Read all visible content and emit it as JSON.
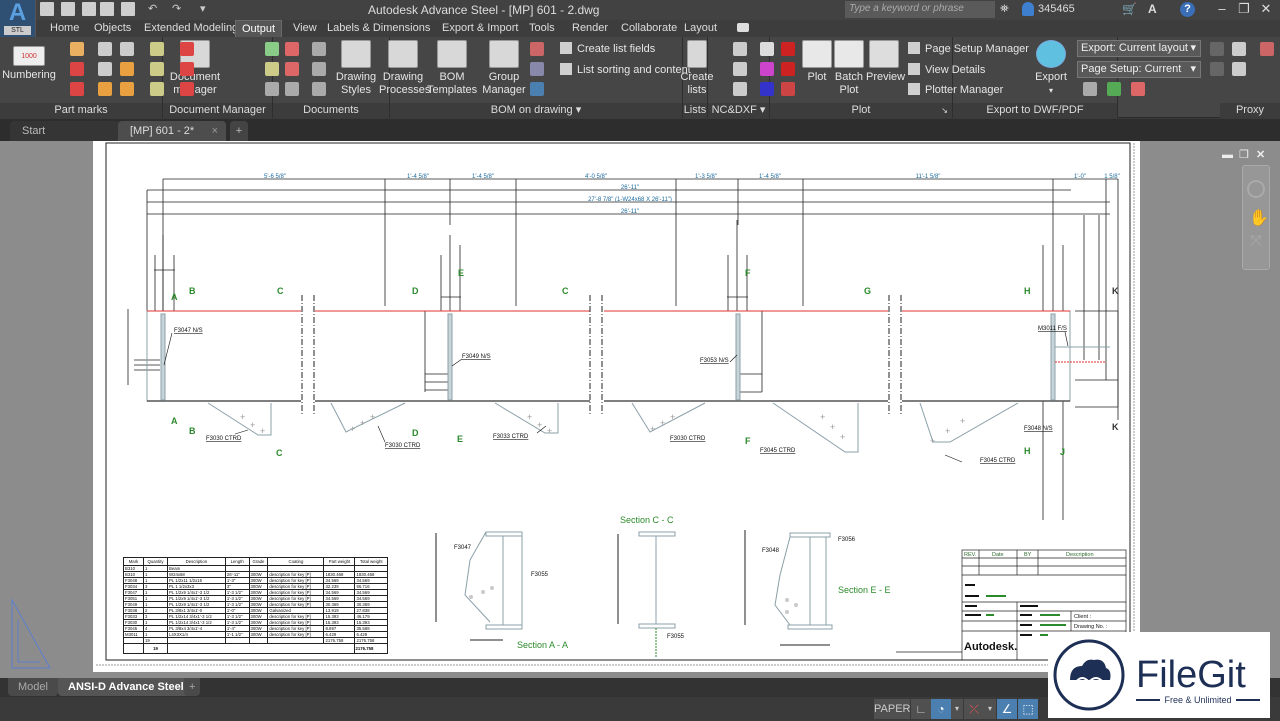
{
  "app": {
    "logo": "A",
    "logo_sub": "STL",
    "title": "Autodesk Advance Steel -  [MP] 601 - 2.dwg",
    "search_placeholder": "Type a keyword or phrase",
    "user": "345465"
  },
  "qat_icons": [
    "new-icon",
    "open-icon",
    "save-icon",
    "save-as-icon",
    "plot-icon",
    "undo-icon",
    "redo-icon",
    "customize-icon"
  ],
  "ribbon_tabs": [
    "Home",
    "Objects",
    "Extended Modeling",
    "Output",
    "View",
    "Labels & Dimensions",
    "Export & Import",
    "Tools",
    "Render",
    "Collaborate",
    "Layout"
  ],
  "active_tab": "Output",
  "panels": {
    "part_marks": {
      "label": "Part marks",
      "numbering": "Numbering"
    },
    "document_manager": {
      "label": "Document Manager",
      "button": "Document manager"
    },
    "documents": {
      "label": "Documents",
      "buttons": [
        "Drawing Styles",
        "Drawing Processes",
        "BOM Templates"
      ]
    },
    "bom": {
      "label": "BOM on drawing",
      "group_manager": "Group Manager",
      "create_list_fields": "Create list fields",
      "list_sorting": "List sorting and content"
    },
    "lists": {
      "label": "Lists",
      "button": "Create lists"
    },
    "ncdxf": {
      "label": "NC&DXF"
    },
    "plot": {
      "label": "Plot",
      "buttons": [
        "Plot",
        "Batch Plot",
        "Preview"
      ],
      "page_setup": "Page Setup Manager",
      "view_details": "View Details",
      "plotter_manager": "Plotter Manager"
    },
    "export": {
      "label": "Export to DWF/PDF",
      "button": "Export",
      "export_select": "Export: Current layout",
      "page_setup_select": "Page Setup: Current"
    },
    "proxy": {
      "label": "Proxy"
    }
  },
  "doc_tabs": [
    "Start",
    "[MP] 601 - 2*"
  ],
  "layout_tabs": [
    "Model",
    "ANSI-D Advance Steel"
  ],
  "status": {
    "paper": "PAPER"
  },
  "drawing": {
    "dims_top": [
      "5'-6 5/8\"",
      "1'-4 5/8\"",
      "1'-4 5/8\"",
      "4'-0 5/8\"",
      "1'-3 5/8\"",
      "1'-4 5/8\"",
      "11'-1 5/8\"",
      "1'-0\"",
      "1 5/8\""
    ],
    "dims_overall": [
      "26'-11\"",
      "27'-8 7/8\" (1-W24x68 X 26'-11\")",
      "26'-11\""
    ],
    "parts": [
      "F3047 N/S",
      "F3049 N/S",
      "F3053 N/S",
      "M3011 F/S",
      "F3048 N/S",
      "F3030 CTRD",
      "F3030 CTRD",
      "F3033 CTRD",
      "F3030 CTRD",
      "F3045 CTRD",
      "F3045 CTRD"
    ],
    "section_marks": [
      "A",
      "B",
      "C",
      "D",
      "E",
      "C",
      "F",
      "G",
      "H",
      "K",
      "A",
      "B",
      "D",
      "E",
      "C",
      "F",
      "H",
      "J",
      "K"
    ],
    "sections": [
      "Section A - A",
      "Section C - C",
      "Section E - E"
    ],
    "section_parts": [
      "F3047",
      "F3055",
      "F3048",
      "F3055",
      "F3056"
    ]
  },
  "bom": {
    "headers": [
      "Mark",
      "Quantity",
      "Description",
      "Length",
      "Grade",
      "Coating",
      "Part weight",
      "Total weight"
    ],
    "rows": [
      [
        "B310",
        "1",
        "Beam",
        "",
        "",
        "",
        "",
        ""
      ],
      [
        "B310",
        "1",
        "W24x68",
        "26'-11\"",
        "300W",
        "description for key [P]",
        "1830.468",
        "1830.468"
      ],
      [
        "F3048",
        "1",
        "PL 1/2x11 1/2x15",
        "1'-3\"",
        "300W",
        "description for key [P]",
        "34.569",
        "34.569"
      ],
      [
        "F3034",
        "3",
        "PL 1 1/2x3x3",
        "3\"",
        "300W",
        "description for key [P]",
        "32.239",
        "96.716"
      ],
      [
        "F3047",
        "1",
        "PL 1/2x9 1/4x1'-3 1/2",
        "1'-3 1/2\"",
        "300W",
        "description for key [P]",
        "34.569",
        "34.569"
      ],
      [
        "F3051",
        "1",
        "PL 1/2x9 1/4x1'-3 1/2",
        "1'-3 1/2\"",
        "300W",
        "description for key [P]",
        "34.569",
        "34.569"
      ],
      [
        "F3049",
        "1",
        "PL 1/2x9 1/4x1'-3 1/2",
        "1'-3 1/2\"",
        "300W",
        "description for key [P]",
        "30.369",
        "30.369"
      ],
      [
        "F3038",
        "2",
        "PL 3/8x1 3/4x1'-0",
        "1'-0\"",
        "300W",
        "Galvanized",
        "13.919",
        "27.838"
      ],
      [
        "F3033",
        "3",
        "PL 1/2x14 3/4x1'-3 1/2",
        "1'-3 1/2\"",
        "300W",
        "description for key [P]",
        "15.393",
        "46.179"
      ],
      [
        "F3030",
        "1",
        "PL 1/2x14 3/4x1'-3 1/2",
        "1'-3 1/2\"",
        "300W",
        "description for key [P]",
        "15.393",
        "15.393"
      ],
      [
        "F3045",
        "4",
        "PL 3/8x4 3/4x1'-4",
        "1'-4\"",
        "300W",
        "description for key [P]",
        "8.897",
        "35.588"
      ],
      [
        "M3011",
        "1",
        "L4X3X1/4",
        "1'-1 1/2\"",
        "300W",
        "description for key [P]",
        "6.429",
        "6.429"
      ],
      [
        "",
        "19",
        "",
        "",
        "",
        "",
        "2176.758",
        "2176.758"
      ]
    ],
    "total_qty": "19",
    "total_weight": "2176.758"
  },
  "title_block": {
    "headers": [
      "REV.",
      "Date",
      "BY",
      "Description"
    ],
    "client": "Client :",
    "drawing_no": "Drawing No. :",
    "logo": "Autodesk."
  },
  "watermark": {
    "name": "FileGit",
    "tagline": "Free & Unlimited"
  },
  "colors": {
    "accent": "#4a7fb0",
    "dim": "#1b6a9c",
    "section": "#2b8a2b",
    "flange": "#e03030"
  }
}
